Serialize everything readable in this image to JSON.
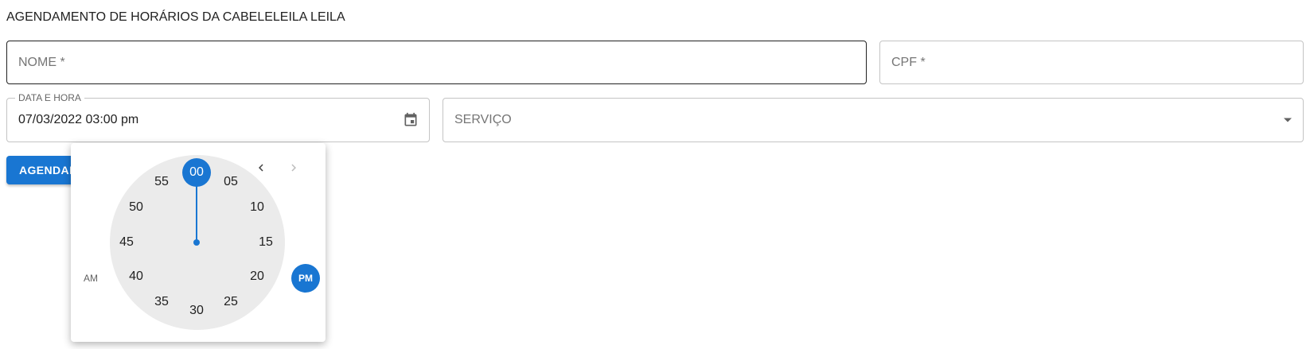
{
  "page": {
    "title": "AGENDAMENTO DE HORÁRIOS DA CABELELEILA LEILA"
  },
  "form": {
    "nome_placeholder": "NOME *",
    "cpf_placeholder": "CPF *",
    "data_label": "DATA E HORA",
    "data_value": "07/03/2022 03:00 pm",
    "servico_placeholder": "SERVIÇO",
    "submit_label": "AGENDAR"
  },
  "picker": {
    "minutes": [
      "00",
      "05",
      "10",
      "15",
      "20",
      "25",
      "30",
      "35",
      "40",
      "45",
      "50",
      "55"
    ],
    "selected_minute": "00",
    "am_label": "AM",
    "pm_label": "PM",
    "selected_period": "PM"
  },
  "icons": {
    "calendar": "calendar-icon",
    "dropdown": "arrow-drop-down-icon",
    "prev": "chevron-left-icon",
    "next": "chevron-right-icon"
  },
  "colors": {
    "accent": "#1976d2",
    "clock_face": "#ebebeb"
  }
}
